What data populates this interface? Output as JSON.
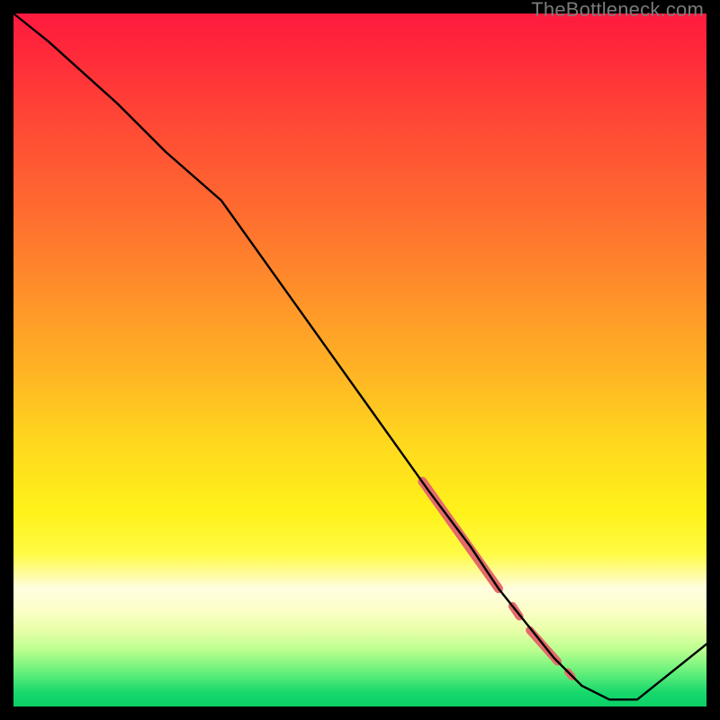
{
  "watermark": "TheBottleneck.com",
  "colors": {
    "line": "#000000",
    "highlight": "#e46a6a",
    "background_top": "#ff1a3e",
    "background_bottom": "#0bcf66"
  },
  "chart_data": {
    "type": "line",
    "title": "",
    "xlabel": "",
    "ylabel": "",
    "xlim": [
      0,
      100
    ],
    "ylim": [
      0,
      100
    ],
    "grid": false,
    "series": [
      {
        "name": "curve",
        "x": [
          0,
          5,
          15,
          22,
          30,
          40,
          50,
          60,
          66,
          70,
          74,
          78,
          82,
          86,
          90,
          100
        ],
        "y": [
          100,
          96,
          87,
          80,
          73,
          59,
          45,
          31,
          23,
          17,
          12,
          7,
          3,
          1,
          1,
          9
        ]
      }
    ],
    "highlight_segments": [
      {
        "x": [
          59,
          70
        ],
        "y": [
          32.5,
          17
        ],
        "width": 10
      },
      {
        "x": [
          72,
          73
        ],
        "y": [
          14.5,
          13
        ],
        "width": 9
      },
      {
        "x": [
          74.5,
          78.5
        ],
        "y": [
          11,
          6.5
        ],
        "width": 9
      },
      {
        "x": [
          80,
          80.6
        ],
        "y": [
          5,
          4.3
        ],
        "width": 8
      }
    ]
  }
}
